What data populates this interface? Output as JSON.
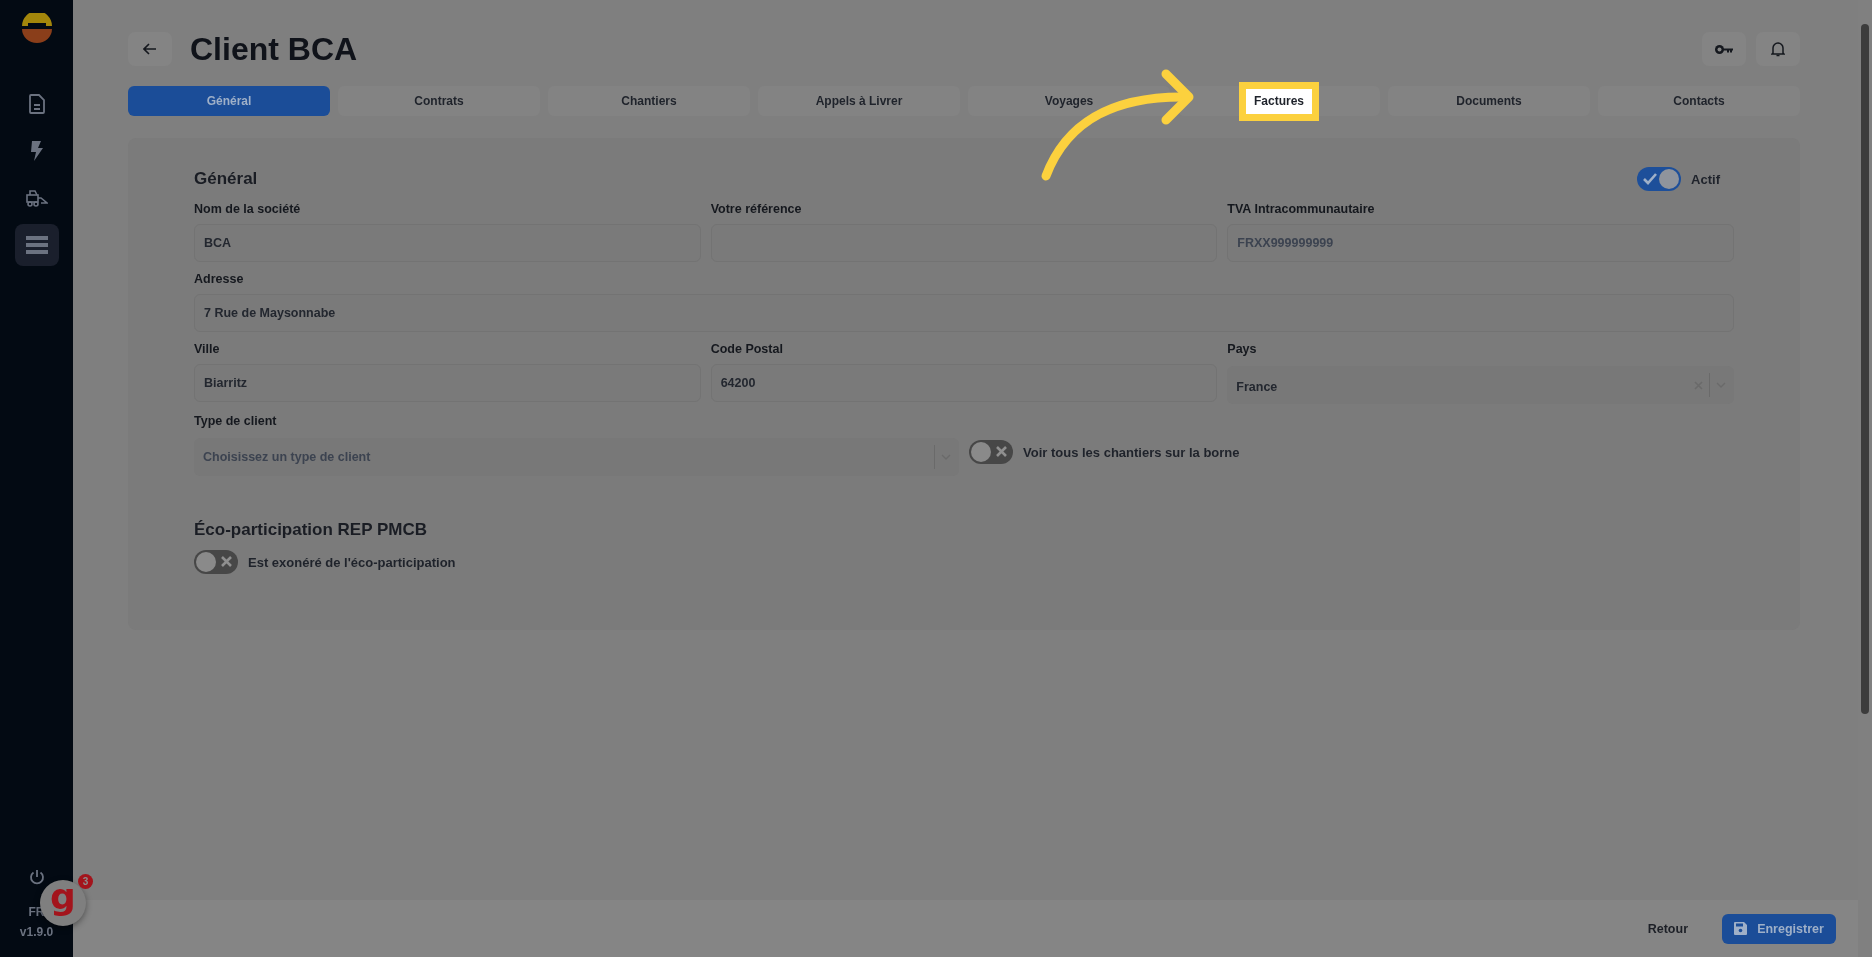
{
  "nav": [
    {
      "kind": "document",
      "selected": false
    },
    {
      "kind": "bolt",
      "selected": false
    },
    {
      "kind": "truck",
      "selected": false
    },
    {
      "kind": "list",
      "selected": true
    }
  ],
  "sidebar_footer": {
    "language": "FR",
    "version": "v1.9.0"
  },
  "help_widget": {
    "label": "g",
    "badge": "3"
  },
  "header": {
    "title": "Client BCA"
  },
  "tabs": [
    {
      "label": "Général",
      "selected": true,
      "highlighted": false
    },
    {
      "label": "Contrats",
      "selected": false,
      "highlighted": false
    },
    {
      "label": "Chantiers",
      "selected": false,
      "highlighted": false
    },
    {
      "label": "Appels à Livrer",
      "selected": false,
      "highlighted": false
    },
    {
      "label": "Voyages",
      "selected": false,
      "highlighted": false
    },
    {
      "label": "Factures",
      "selected": false,
      "highlighted": true
    },
    {
      "label": "Documents",
      "selected": false,
      "highlighted": false
    },
    {
      "label": "Contacts",
      "selected": false,
      "highlighted": false
    }
  ],
  "general": {
    "title": "Général",
    "status_toggle": {
      "label": "Actif",
      "on": true
    },
    "rows": [
      [
        {
          "kind": "input",
          "label": "Nom de la société",
          "value": "BCA"
        },
        {
          "kind": "input",
          "label": "Votre référence"
        },
        {
          "kind": "input",
          "label": "TVA Intracommunautaire",
          "placeholder": "FRXX999999999"
        }
      ],
      [
        {
          "kind": "input",
          "label": "Adresse",
          "value": "7 Rue de Maysonnabe"
        }
      ],
      [
        {
          "kind": "input",
          "label": "Ville",
          "value": "Biarritz"
        },
        {
          "kind": "input",
          "label": "Code Postal",
          "value": "64200"
        },
        {
          "kind": "select",
          "label": "Pays",
          "value": "France"
        }
      ],
      [
        {
          "kind": "select",
          "label": "Type de client",
          "placeholder": "Choisissez un type de client"
        },
        {
          "kind": "toggle",
          "label": "Voir tous les chantiers sur la borne",
          "on": false
        }
      ]
    ]
  },
  "eco": {
    "title": "Éco-participation REP PMCB",
    "toggle": {
      "label": "Est exonéré de l'éco-participation",
      "on": false
    }
  },
  "footer": {
    "back": "Retour",
    "save": "Enregistrer"
  }
}
